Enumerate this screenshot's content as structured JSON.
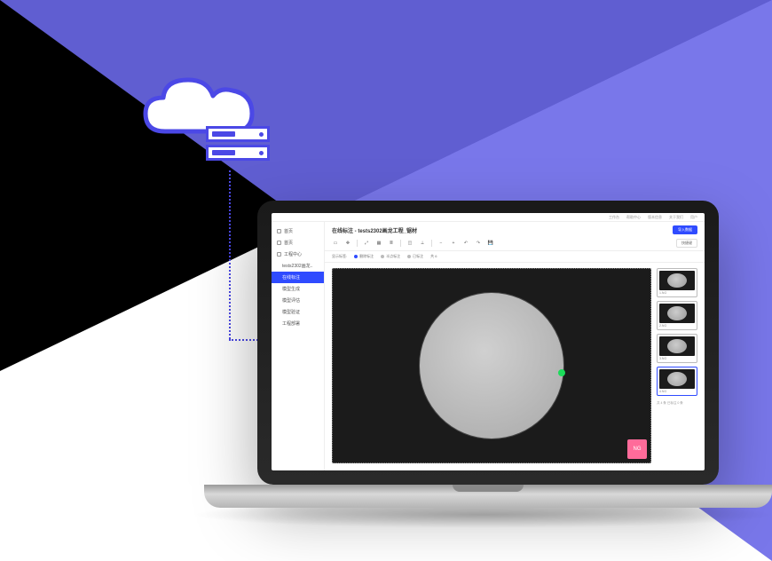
{
  "topNav": {
    "items": [
      "工作台",
      "帮助中心",
      "版本信息",
      "关于我们",
      "用户"
    ]
  },
  "sidebar": {
    "items": [
      {
        "label": "首页"
      },
      {
        "label": "首页"
      },
      {
        "label": "工程中心"
      },
      {
        "label": "tests2302画龙..",
        "sub": true
      },
      {
        "label": "在线标注",
        "sub": true,
        "active": true
      },
      {
        "label": "模型生成",
        "sub": true
      },
      {
        "label": "模型评估",
        "sub": true
      },
      {
        "label": "模型验证",
        "sub": true
      },
      {
        "label": "工程部署",
        "sub": true
      }
    ]
  },
  "header": {
    "title": "在线标注 - tests2302画龙工程_锯材",
    "primaryButton": "导入数据"
  },
  "toolbar": {
    "outlineButton": "快捷键",
    "icons": [
      "pointer",
      "move",
      "resize",
      "grid",
      "list",
      "crop",
      "ruler",
      "zoom-out",
      "zoom-in",
      "undo",
      "redo",
      "save"
    ]
  },
  "filterbar": {
    "label": "显示标签:",
    "chips": [
      {
        "label": "删除标注",
        "color": "#2f4bff"
      },
      {
        "label": "半点标注",
        "color": "#888"
      },
      {
        "label": "已标注",
        "color": "#888"
      }
    ],
    "count": "共 6"
  },
  "canvas": {
    "ngLabel": "NG"
  },
  "thumbs": {
    "items": [
      {
        "label": "1.NG"
      },
      {
        "label": "2.NG"
      },
      {
        "label": "3.NG"
      },
      {
        "label": "4.NG",
        "selected": true
      }
    ],
    "footer": "共 4 条  已标注 0 条"
  }
}
